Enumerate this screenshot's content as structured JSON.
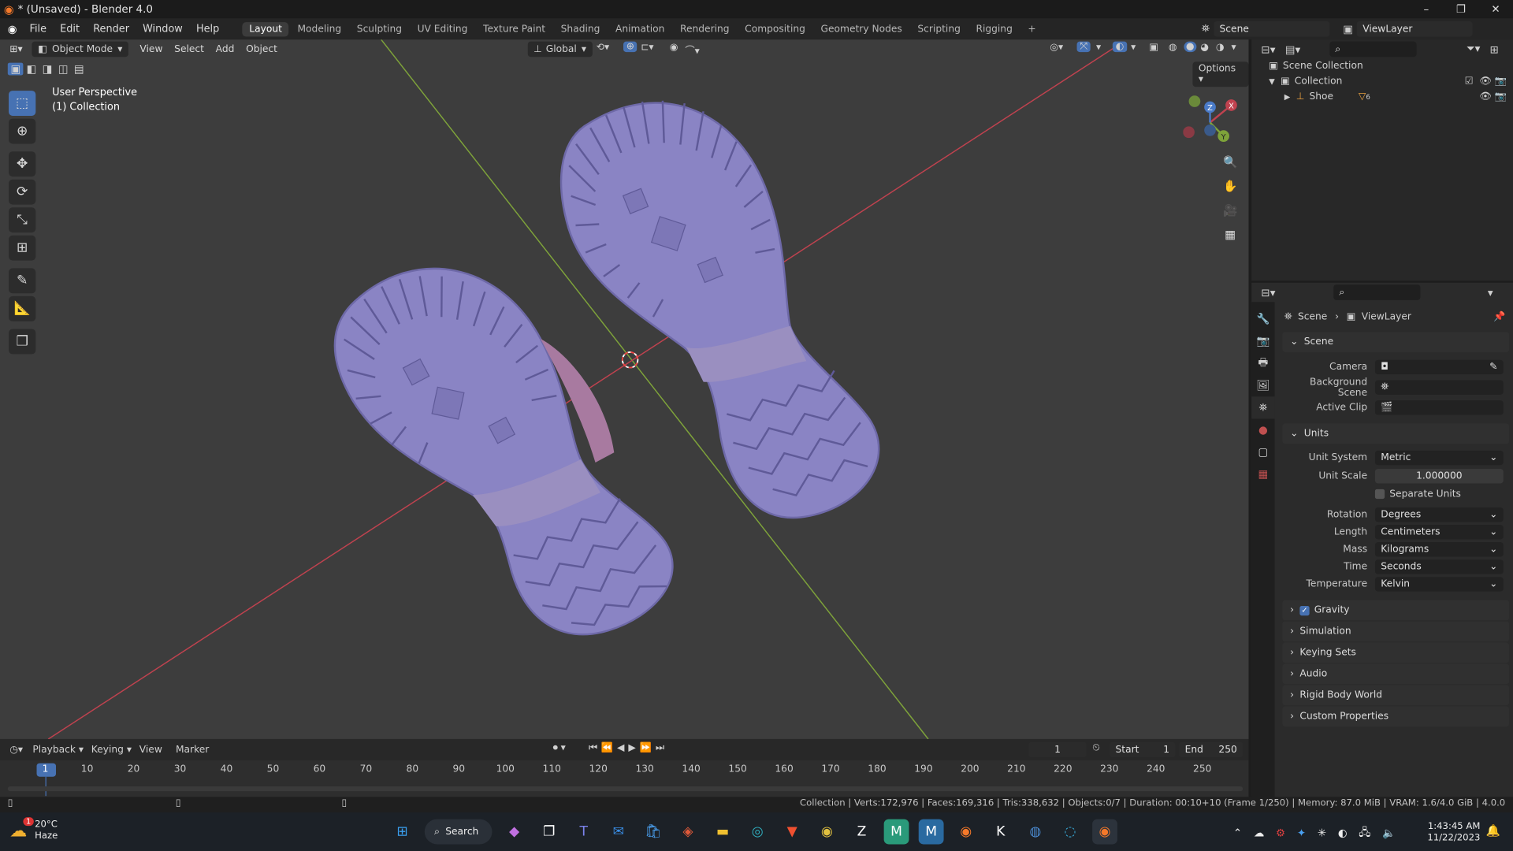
{
  "window": {
    "title": "* (Unsaved) - Blender 4.0",
    "min": "–",
    "max": "❐",
    "close": "✕"
  },
  "menu": [
    "File",
    "Edit",
    "Render",
    "Window",
    "Help"
  ],
  "workspaces": [
    "Layout",
    "Modeling",
    "Sculpting",
    "UV Editing",
    "Texture Paint",
    "Shading",
    "Animation",
    "Rendering",
    "Compositing",
    "Geometry Nodes",
    "Scripting",
    "Rigging",
    "+"
  ],
  "scene_field": "Scene",
  "viewlayer_field": "ViewLayer",
  "viewport": {
    "mode": "Object Mode",
    "menus": [
      "View",
      "Select",
      "Add",
      "Object"
    ],
    "orientation": "Global",
    "options": "Options",
    "info_line1": "User Perspective",
    "info_line2": "(1) Collection",
    "gizmo": {
      "x": "X",
      "y": "Y",
      "z": "Z"
    }
  },
  "outliner": {
    "root": "Scene Collection",
    "collection": "Collection",
    "object": "Shoe",
    "object_badge": "6"
  },
  "properties": {
    "breadcrumb_scene": "Scene",
    "breadcrumb_viewlayer": "ViewLayer",
    "panel_scene": "Scene",
    "camera_label": "Camera",
    "background_scene_label": "Background Scene",
    "active_clip_label": "Active Clip",
    "panel_units": "Units",
    "unit_system_label": "Unit System",
    "unit_system": "Metric",
    "unit_scale_label": "Unit Scale",
    "unit_scale": "1.000000",
    "separate_units": "Separate Units",
    "rotation_label": "Rotation",
    "rotation": "Degrees",
    "length_label": "Length",
    "length": "Centimeters",
    "mass_label": "Mass",
    "mass": "Kilograms",
    "time_label": "Time",
    "time": "Seconds",
    "temperature_label": "Temperature",
    "temperature": "Kelvin",
    "collapsed": [
      "Gravity",
      "Simulation",
      "Keying Sets",
      "Audio",
      "Rigid Body World",
      "Custom Properties"
    ]
  },
  "timeline": {
    "menus": [
      "Playback",
      "Keying",
      "View",
      "Marker"
    ],
    "current_frame": "1",
    "start_label": "Start",
    "start": "1",
    "end_label": "End",
    "end": "250",
    "ticks": [
      "1",
      "10",
      "20",
      "30",
      "40",
      "50",
      "60",
      "70",
      "80",
      "90",
      "100",
      "110",
      "120",
      "130",
      "140",
      "150",
      "160",
      "170",
      "180",
      "190",
      "200",
      "210",
      "220",
      "230",
      "240",
      "250"
    ]
  },
  "status": "Collection | Verts:172,976 | Faces:169,316 | Tris:338,632 | Objects:0/7 | Duration: 00:10+10 (Frame 1/250) | Memory: 87.0 MiB | VRAM: 1.6/4.0 GiB | 4.0.0",
  "taskbar": {
    "weather_temp": "20°C",
    "weather_desc": "Haze",
    "weather_badge": "1",
    "search": "Search",
    "time": "1:43:45 AM",
    "date": "11/22/2023"
  },
  "colors": {
    "x_axis": "#c0424f",
    "y_axis": "#7ea33a",
    "shoe": "#8a84c4",
    "accent": "#4772b3"
  }
}
